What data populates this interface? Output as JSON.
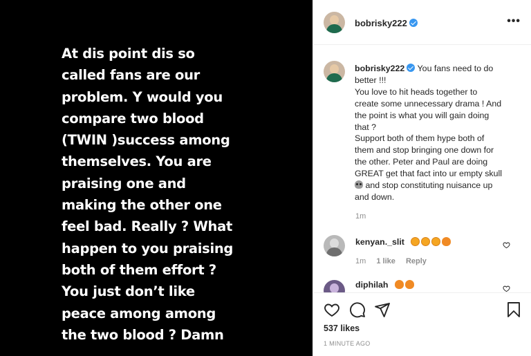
{
  "story": {
    "lines": [
      "At dis point dis so",
      "called fans are our",
      "problem. Y would you",
      "compare two blood",
      "(TWIN )success among",
      "themselves. You are",
      "praising one and",
      "making the other one",
      "feel bad. Really ? What",
      "happen to you praising",
      "both of them effort ?",
      "You just don’t like",
      "peace among among",
      "the two blood ? Damn"
    ]
  },
  "header": {
    "username": "bobrisky222",
    "more": "•••"
  },
  "caption": {
    "username": "bobrisky222",
    "lines": [
      "You fans need to do",
      "better !!!",
      "You love to hit heads together to",
      "create some unnecessary drama ! And",
      "the point is what you will gain doing",
      "that ?",
      "Support both of them hype both of",
      "them and stop bringing one down for",
      "the other. Peter and Paul are doing",
      "GREAT get that fact into ur empty skull",
      "and stop constituting nuisance up",
      "and down."
    ],
    "time": "1m"
  },
  "comments": [
    {
      "username": "kenyan._slit",
      "time": "1m",
      "likes": "1 like",
      "reply": "Reply"
    },
    {
      "username": "diphilah"
    }
  ],
  "actions": {
    "likes": "537 likes",
    "posted": "1 MINUTE AGO"
  }
}
